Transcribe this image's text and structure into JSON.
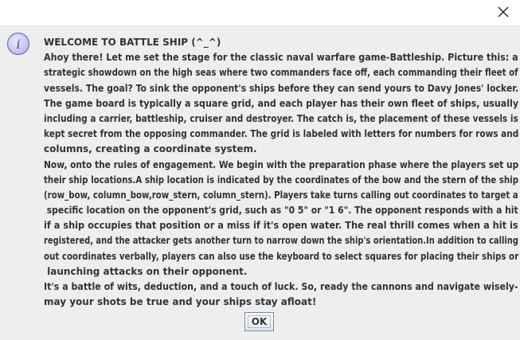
{
  "window": {
    "close_icon": "close-icon"
  },
  "dialog": {
    "icon": "info-icon",
    "icon_glyph": "i",
    "message_lines": [
      "WELCOME TO BATTLE SHIP (^_^)",
      "Ahoy there! Let me set the stage for the classic naval warfare game-Battleship. Picture this: a",
      "strategic showdown on the high seas where two commanders face off, each commanding their fleet of",
      "vessels. The goal? To sink the opponent's ships before they can send yours to Davy Jones' locker.",
      "The game board is typically a square grid, and each player has their own fleet of ships, usually",
      "including a carrier, battleship, cruiser and destroyer. The catch is, the placement of these vessels is",
      "kept secret from the opposing commander. The grid is labeled with letters for numbers for rows and",
      "columns, creating a coordinate system.",
      "Now, onto the rules of engagement. We begin with the preparation phase where the players set up",
      "their ship locations.A ship location is indicated by the coordinates of the bow and the stern of the ship",
      "(row_bow, column_bow,row_stern, column_stern). Players take turns calling out coordinates to target a",
      " specific location on the opponent's grid, such as \"0 5\" or \"1 6\". The opponent responds with a hit",
      "if a ship occupies that position or a miss if it's open water. The real thrill comes when a hit is",
      "registered, and the attacker gets another turn to narrow down the ship's orientation.In addition to calling",
      "out coordinates verbally, players can also use the keyboard to select squares for placing their ships or",
      " launching attacks on their opponent.",
      "It's a battle of wits, deduction, and a touch of luck. So, ready the cannons and navigate wisely-",
      "may your shots be true and your ships stay afloat!"
    ],
    "ok_label": "OK"
  },
  "colors": {
    "content_bg": "#eeeeee",
    "titlebar_bg": "#ffffff",
    "text": "#333333",
    "icon_fill": "#c8c8f5",
    "icon_stroke": "#7272c6"
  }
}
